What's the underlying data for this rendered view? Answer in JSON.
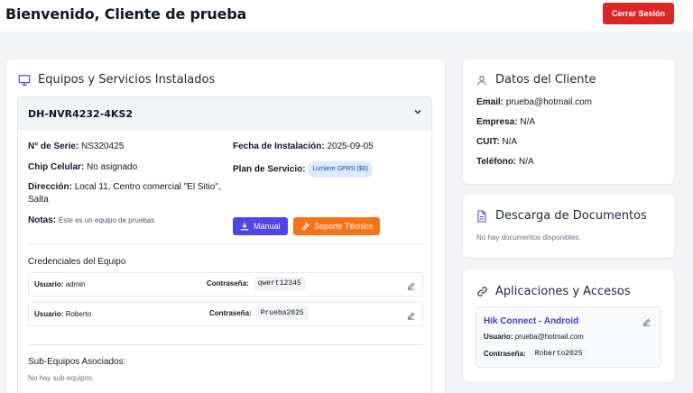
{
  "header": {
    "title": "Bienvenido, Cliente de prueba",
    "logout_label": "Cerrar Sesión"
  },
  "equipment": {
    "section_title": "Equipos y Servicios Instalados",
    "device_name": "DH-NVR4232-4KS2",
    "serial_label": "N° de Serie:",
    "serial_value": "NS320425",
    "chip_label": "Chip Celular:",
    "chip_value": "No asignado",
    "address_label": "Dirección:",
    "address_value": "Local 11, Centro comercial \"El Sitio\",",
    "address_value_2": "Salta",
    "install_label": "Fecha de Instalación:",
    "install_value": "2025-09-05",
    "plan_label": "Plan de Servicio:",
    "plan_value": "Lumiere GPRS ($0)",
    "manual_label": "Manual",
    "support_label": "Soporte Técnico",
    "notes_label": "Notas:",
    "notes_value": "Éste es un equipo de pruebas",
    "credentials_title": "Credenciales del Equipo",
    "credentials": [
      {
        "user_label": "Usuario:",
        "user": "admin",
        "pass_label": "Contraseña:",
        "pass": "qwert12345"
      },
      {
        "user_label": "Usuario:",
        "user": "Roberto",
        "pass_label": "Contraseña:",
        "pass": "Prueba2025"
      }
    ],
    "sub_title": "Sub-Equipos Asociados:",
    "sub_empty": "No hay sub-equipos."
  },
  "client": {
    "title": "Datos del Cliente",
    "email_label": "Email:",
    "email": "prueba@hotmail.com",
    "company_label": "Empresa:",
    "company": "N/A",
    "cuit_label": "CUIT:",
    "cuit": "N/A",
    "phone_label": "Teléfono:",
    "phone": "N/A"
  },
  "documents": {
    "title": "Descarga de Documentos",
    "empty": "No hay documentos disponibles."
  },
  "apps": {
    "title": "Aplicaciones y Accesos",
    "app_name": "Hik Connect - Android",
    "user_label": "Usuario:",
    "user": "prueba@hotmail.com",
    "pass_label": "Contraseña:",
    "pass": "Roberto2025"
  },
  "colors": {
    "logout": "#dc2626",
    "manual": "#4f46e5",
    "support": "#f97316",
    "link": "#4338ca"
  }
}
